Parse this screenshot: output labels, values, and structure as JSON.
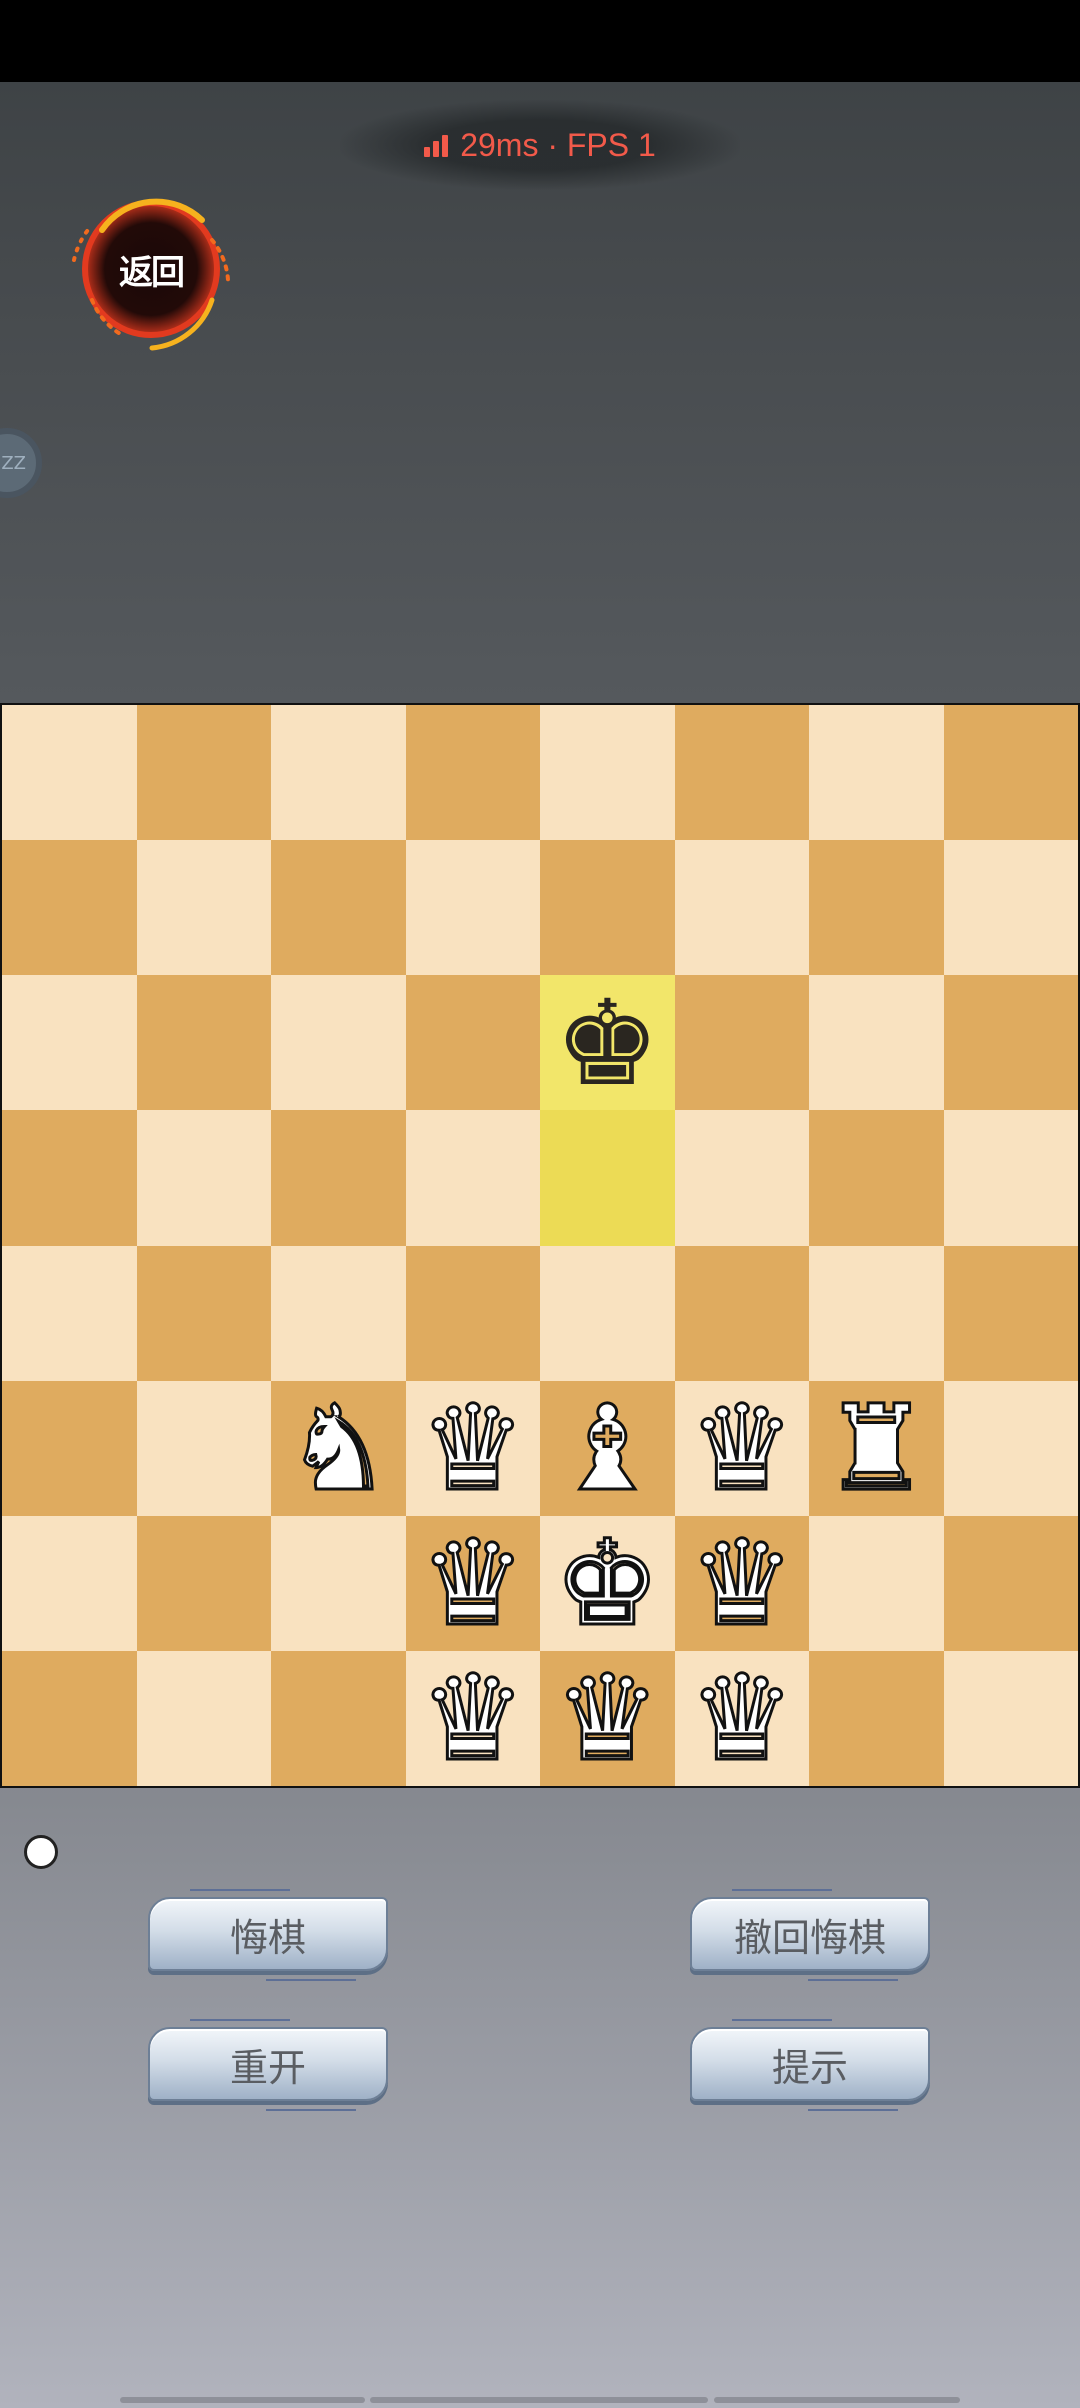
{
  "status": {
    "latency_text": "29ms · FPS 1",
    "color": "#f25a4a"
  },
  "back_button": {
    "label": "返回"
  },
  "side_handle": {
    "label": "ZZ"
  },
  "board": {
    "colors": {
      "light": "#f9e2c0",
      "dark": "#dfab5f",
      "highlight": "#ecdb55"
    },
    "ranks": [
      [
        "",
        "",
        "",
        "",
        "",
        "",
        "",
        ""
      ],
      [
        "",
        "",
        "",
        "",
        "",
        "",
        "",
        ""
      ],
      [
        "",
        "",
        "",
        "",
        "♚",
        "",
        "",
        ""
      ],
      [
        "",
        "",
        "",
        "",
        "",
        "",
        "",
        ""
      ],
      [
        "",
        "",
        "",
        "",
        "",
        "",
        "",
        ""
      ],
      [
        "",
        "",
        "♞",
        "♛",
        "♝",
        "♛",
        "♜",
        ""
      ],
      [
        "",
        "",
        "",
        "♛",
        "♚",
        "♛",
        "",
        ""
      ],
      [
        "",
        "",
        "",
        "♛",
        "♛",
        "♛",
        "",
        ""
      ]
    ],
    "piece_colors": [
      [
        "",
        "",
        "",
        "",
        "",
        "",
        "",
        ""
      ],
      [
        "",
        "",
        "",
        "",
        "",
        "",
        "",
        ""
      ],
      [
        "",
        "",
        "",
        "",
        "black",
        "",
        "",
        ""
      ],
      [
        "",
        "",
        "",
        "",
        "",
        "",
        "",
        ""
      ],
      [
        "",
        "",
        "",
        "",
        "",
        "",
        "",
        ""
      ],
      [
        "",
        "",
        "white",
        "white",
        "white",
        "white",
        "white",
        ""
      ],
      [
        "",
        "",
        "",
        "white",
        "white",
        "white",
        "",
        ""
      ],
      [
        "",
        "",
        "",
        "white",
        "white",
        "white",
        "",
        ""
      ]
    ],
    "highlighted_squares": [
      "e6",
      "e5"
    ]
  },
  "buttons": {
    "undo": "悔棋",
    "redo": "撤回悔棋",
    "restart": "重开",
    "hint": "提示"
  }
}
